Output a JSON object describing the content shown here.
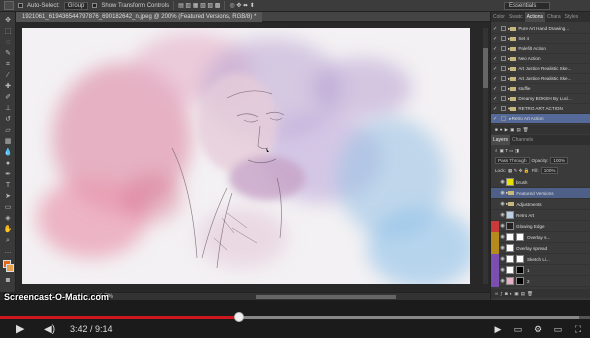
{
  "options_bar": {
    "auto_select_label": "Auto-Select:",
    "auto_select_value": "Group",
    "transform_label": "Show Transform Controls",
    "workspace": "Essentials"
  },
  "document": {
    "tab_title": "1921061_619436544797876_690182642_n.jpeg @ 200% (Featured Versions, RGB/8) *",
    "zoom": "66.7%"
  },
  "panel_tabs": {
    "color": "Color",
    "swatches": "Swatc",
    "actions": "Actions",
    "character": "Chara",
    "styles": "Styles"
  },
  "actions": [
    {
      "label": "Pure Art Hand Drawing...",
      "selected": false
    },
    {
      "label": "Set 4",
      "selected": false
    },
    {
      "label": "Palefilt Action",
      "selected": false
    },
    {
      "label": "Neo Action",
      "selected": false
    },
    {
      "label": "Art Justice Realistic Ske...",
      "selected": false
    },
    {
      "label": "Art Justice Realistic Ske...",
      "selected": false
    },
    {
      "label": "stuffie",
      "selected": false
    },
    {
      "label": "Dreamy BOKEH By Luci...",
      "selected": false
    },
    {
      "label": "RETRO ART ACTION",
      "selected": false
    },
    {
      "label": "Retro Art Action",
      "selected": true
    }
  ],
  "layers_panel": {
    "tab_layers": "Layers",
    "tab_channels": "Channels",
    "blend_mode": "Pass Through",
    "opacity_label": "Opacity:",
    "opacity_value": "100%",
    "lock_label": "Lock:",
    "fill_label": "Fill:",
    "fill_value": "100%"
  },
  "layers": [
    {
      "name": "brush",
      "type": "layer"
    },
    {
      "name": "Featured Versions",
      "type": "group",
      "selected": true
    },
    {
      "name": "Adjustments",
      "type": "group"
    },
    {
      "name": "Retro Art",
      "type": "layer"
    },
    {
      "name": "Glowing Edge",
      "type": "layer"
    },
    {
      "name": "Overlay s...",
      "type": "layer"
    },
    {
      "name": "Overlay spread",
      "type": "layer"
    },
    {
      "name": "Sketch Li...",
      "type": "layer"
    },
    {
      "name": "1",
      "type": "layer"
    },
    {
      "name": "2",
      "type": "layer"
    }
  ],
  "watermark": "Screencast-O-Matic.com",
  "player": {
    "current_time": "3:42",
    "duration": "9:14",
    "progress": 0.405
  },
  "colors": {
    "accent": "#cc181e",
    "selection": "#556a99",
    "foreground": "#e06a1a"
  }
}
